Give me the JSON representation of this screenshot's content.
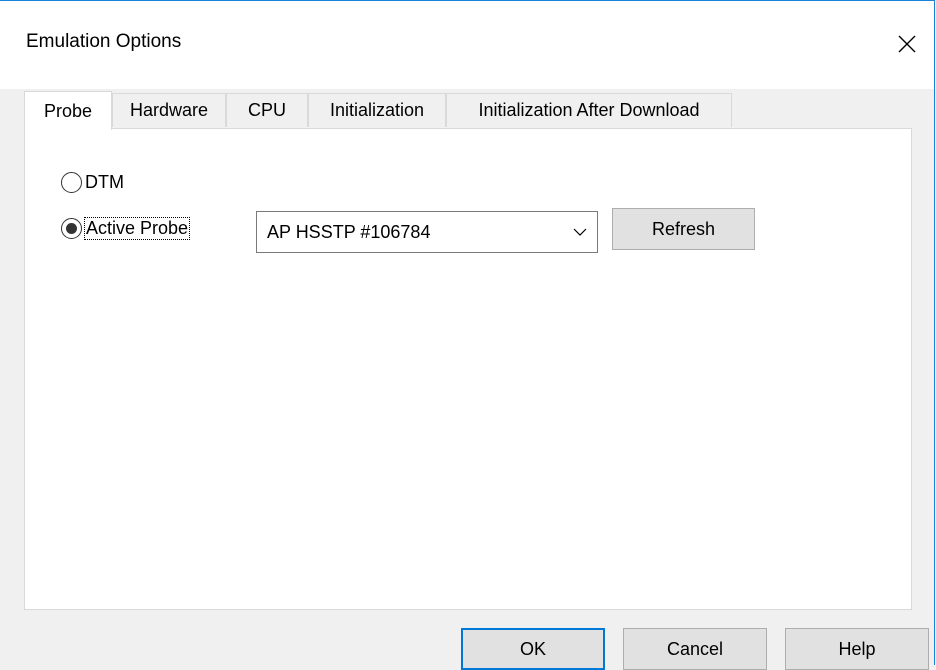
{
  "window": {
    "title": "Emulation Options"
  },
  "tabs": [
    {
      "label": "Probe",
      "active": true
    },
    {
      "label": "Hardware",
      "active": false
    },
    {
      "label": "CPU",
      "active": false
    },
    {
      "label": "Initialization",
      "active": false
    },
    {
      "label": "Initialization After Download",
      "active": false
    }
  ],
  "probe": {
    "options": [
      {
        "label": "DTM",
        "selected": false
      },
      {
        "label": "Active Probe",
        "selected": true
      }
    ],
    "device_select": {
      "value": "AP HSSTP #106784"
    },
    "refresh_label": "Refresh"
  },
  "footer": {
    "ok_label": "OK",
    "cancel_label": "Cancel",
    "help_label": "Help"
  },
  "colors": {
    "accent": "#0078d7",
    "window_border": "#1883d7"
  }
}
